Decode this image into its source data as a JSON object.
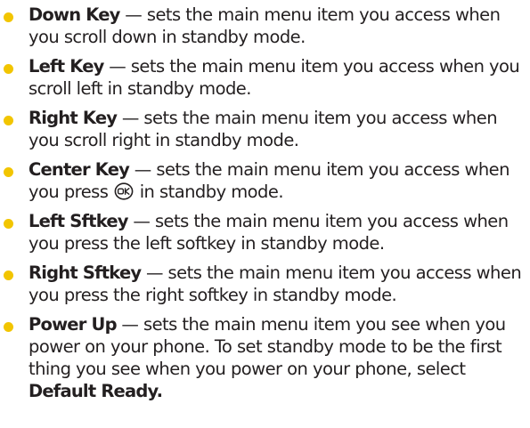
{
  "colors": {
    "bullet": "#f2c500",
    "text": "#231f20"
  },
  "items": [
    {
      "term": "Down Key",
      "desc": "— sets the main menu item you access when you scroll down in standby mode."
    },
    {
      "term": "Left Key",
      "desc": "— sets the main menu item you access when you scroll left in standby mode."
    },
    {
      "term": "Right Key",
      "desc": "— sets the main menu item you access when you scroll right in standby mode."
    },
    {
      "term": "Center Key",
      "desc_before_icon": "— sets the main menu item you access when you press",
      "icon": "ok-key-icon",
      "desc_after_icon": "in standby mode."
    },
    {
      "term": "Left Sftkey",
      "desc": "— sets the main menu item you access when you press the left softkey in standby mode."
    },
    {
      "term": "Right Sftkey",
      "desc": "— sets the main menu item you access when you press the right softkey in standby mode."
    },
    {
      "term": "Power Up",
      "desc": "— sets the main menu item you see when you power on your phone. To set standby mode to be the first thing you see when you power on your phone, select",
      "emphasis": "Default Ready."
    }
  ]
}
